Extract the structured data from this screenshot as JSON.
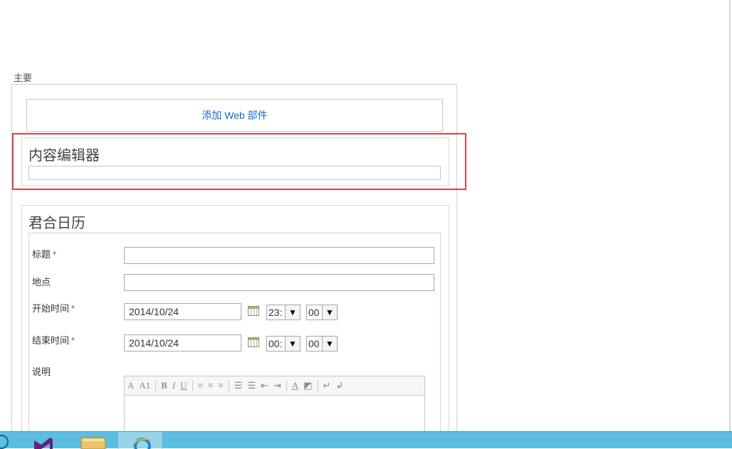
{
  "zone": {
    "title": "主要"
  },
  "add_webpart": {
    "label": "添加 Web 部件"
  },
  "content_editor": {
    "title": "内容编辑器"
  },
  "calendar": {
    "title": "君合日历",
    "fields": {
      "title_label": "标题",
      "location_label": "地点",
      "start_label": "开始时间",
      "end_label": "结束时间",
      "description_label": "说明",
      "required_mark": "*",
      "start_date": "2014/10/24",
      "start_hour": "23:",
      "start_minute": "00",
      "end_date": "2014/10/24",
      "end_hour": "00:",
      "end_minute": "00"
    },
    "rte_toolbar": {
      "font": "A",
      "font_size": "A1",
      "bold": "B",
      "italic": "I",
      "underline": "U"
    }
  },
  "colors": {
    "accent": "#0f6fc6",
    "highlight": "#d8404a",
    "taskbar": "#5cbee0"
  }
}
